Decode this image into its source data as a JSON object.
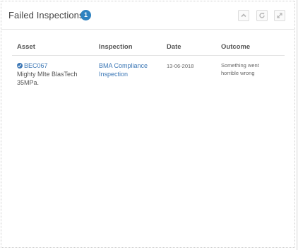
{
  "widget": {
    "title": "Failed Inspections",
    "count": "1"
  },
  "toolbar": {
    "collapse_icon": "chevron-up-icon",
    "refresh_icon": "refresh-icon",
    "expand_icon": "expand-icon"
  },
  "table": {
    "headers": [
      "Asset",
      "Inspection",
      "Date",
      "Outcome"
    ],
    "rows": [
      {
        "asset_code": "BEC067",
        "asset_name": "Mighty MIte BlasTech 35MPa.",
        "inspection": "BMA Compliance Inspection",
        "date": "13-06-2018",
        "outcome": "Something went horrible wrong"
      }
    ]
  },
  "colors": {
    "accent": "#2f82c0",
    "link": "#3a76b5"
  }
}
